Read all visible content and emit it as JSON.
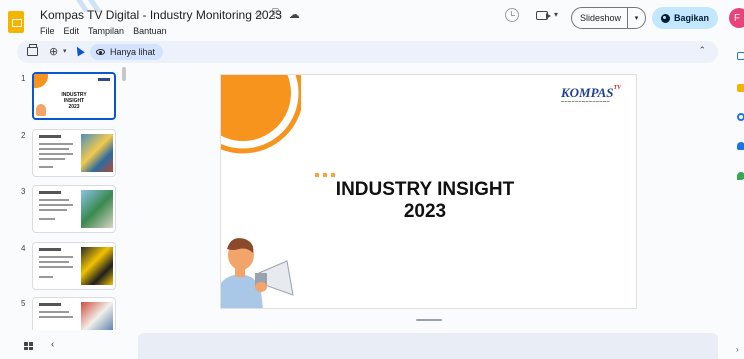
{
  "app": {
    "doc_title": "Kompas TV Digital - Industry Monitoring 2023",
    "menu": [
      "File",
      "Edit",
      "Tampilan",
      "Bantuan"
    ]
  },
  "header": {
    "slideshow_label": "Slideshow",
    "share_label": "Bagikan",
    "avatar_initial": "F"
  },
  "toolbar": {
    "view_mode_label": "Hanya lihat"
  },
  "filmstrip": {
    "slides": [
      {
        "number": "1",
        "title_line1": "INDUSTRY INSIGHT",
        "title_line2": "2023",
        "style": "cover",
        "active": true
      },
      {
        "number": "2",
        "style": "content",
        "pic": ""
      },
      {
        "number": "3",
        "style": "content",
        "pic": "alt"
      },
      {
        "number": "4",
        "style": "content",
        "pic": "dark"
      },
      {
        "number": "5",
        "style": "content",
        "pic": "red"
      }
    ]
  },
  "slide": {
    "brand_name": "KOMPAS",
    "brand_sup": "TV",
    "title_line1": "INDUSTRY INSIGHT",
    "title_line2": "2023"
  },
  "colors": {
    "accent_orange": "#f7941d",
    "brand_blue": "#22428e",
    "brand_red": "#d9232d",
    "share_bg": "#c2e7ff",
    "avatar_bg": "#e8437a",
    "active_blue": "#0b57d0"
  }
}
